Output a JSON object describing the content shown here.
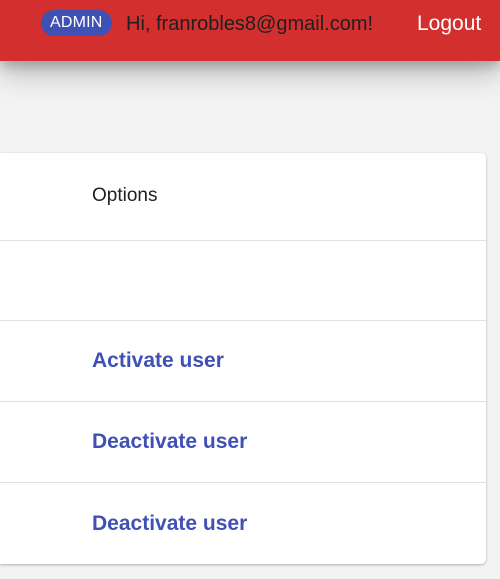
{
  "header": {
    "role_badge": "ADMIN",
    "greeting": "Hi, franrobles8@gmail.com!",
    "logout_label": "Logout",
    "background_color": "#d32f2f",
    "badge_color": "#3f51b5"
  },
  "table": {
    "columns": [
      "Options"
    ],
    "rows": [
      {
        "action": ""
      },
      {
        "action": "Activate user"
      },
      {
        "action": "Deactivate user"
      },
      {
        "action": "Deactivate user"
      }
    ],
    "link_color": "#3f51b5"
  }
}
